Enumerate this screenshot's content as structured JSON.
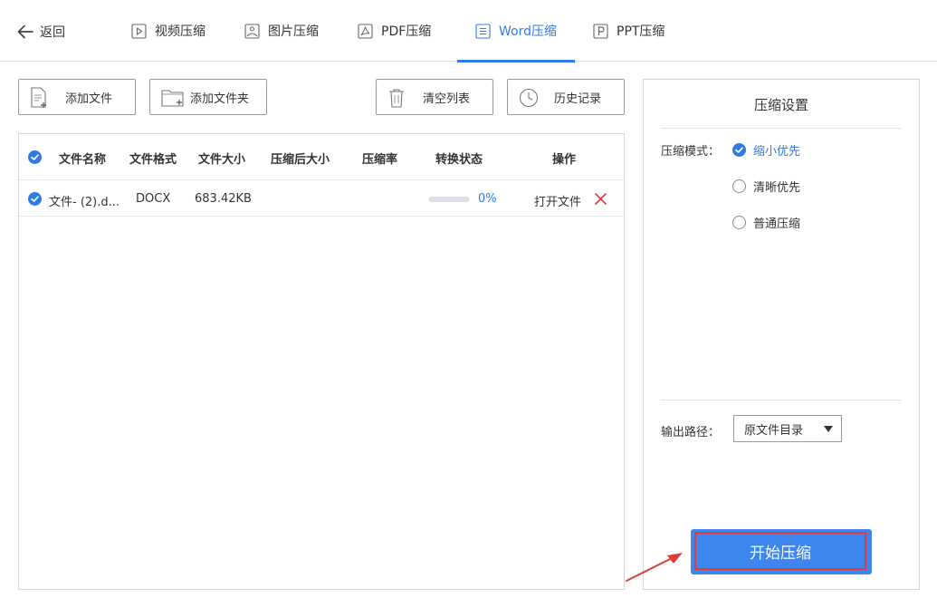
{
  "nav": {
    "back_label": "返回",
    "tabs": [
      {
        "label": "视频压缩",
        "icon": "video-icon"
      },
      {
        "label": "图片压缩",
        "icon": "image-icon"
      },
      {
        "label": "PDF压缩",
        "icon": "pdf-icon"
      },
      {
        "label": "Word压缩",
        "icon": "word-icon",
        "active": true
      },
      {
        "label": "PPT压缩",
        "icon": "ppt-icon"
      }
    ]
  },
  "toolbar": {
    "add_file": "添加文件",
    "add_folder": "添加文件夹",
    "clear_list": "清空列表",
    "history": "历史记录"
  },
  "table": {
    "headers": [
      "文件名称",
      "文件格式",
      "文件大小",
      "压缩后大小",
      "压缩率",
      "转换状态",
      "操作"
    ],
    "rows": [
      {
        "name": "文件- (2).d...",
        "format": "DOCX",
        "size": "683.42KB",
        "compressed_size": "",
        "ratio": "",
        "progress_text": "0%",
        "progress": 0,
        "open_action": "打开文件"
      }
    ]
  },
  "settings": {
    "title": "压缩设置",
    "mode_label": "压缩模式：",
    "modes": [
      {
        "label": "缩小优先",
        "selected": true
      },
      {
        "label": "清晰优先",
        "selected": false
      },
      {
        "label": "普通压缩",
        "selected": false
      }
    ],
    "output_label": "输出路径：",
    "output_value": "原文件目录",
    "start_button": "开始压缩"
  },
  "colors": {
    "accent": "#2f7ae5",
    "button": "#3d86ee",
    "highlight": "#e23a3a"
  }
}
